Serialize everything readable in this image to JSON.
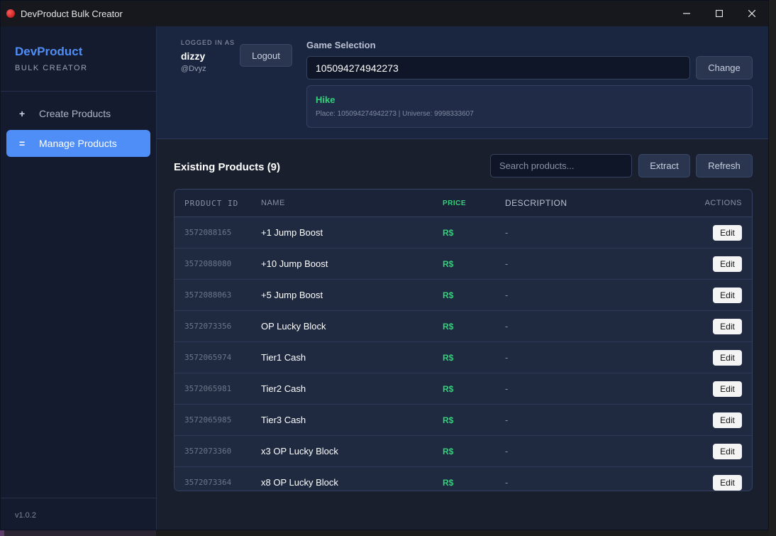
{
  "window": {
    "title": "DevProduct Bulk Creator"
  },
  "sidebar": {
    "brand_title": "DevProduct",
    "brand_subtitle": "BULK CREATOR",
    "items": [
      {
        "icon": "plus-icon",
        "glyph": "+",
        "label": "Create Products",
        "active": false
      },
      {
        "icon": "list-icon",
        "glyph": "=",
        "label": "Manage Products",
        "active": true
      }
    ],
    "version": "v1.0.2"
  },
  "header": {
    "logged_in_label": "LOGGED IN AS",
    "username": "dizzy",
    "handle": "@Dvyz",
    "logout_label": "Logout",
    "game_selection_label": "Game Selection",
    "game_id_value": "105094274942273",
    "change_label": "Change",
    "game": {
      "name": "Hike",
      "meta": "Place: 105094274942273 | Universe: 9998333607"
    }
  },
  "products": {
    "title": "Existing Products (9)",
    "search_placeholder": "Search products...",
    "extract_label": "Extract",
    "refresh_label": "Refresh",
    "columns": {
      "id": "PRODUCT ID",
      "name": "NAME",
      "price": "PRICE",
      "description": "DESCRIPTION",
      "actions": "ACTIONS"
    },
    "rows": [
      {
        "id": "3572088165",
        "name": "+1 Jump Boost",
        "price": "R$",
        "description": "-",
        "action": "Edit"
      },
      {
        "id": "3572088080",
        "name": "+10 Jump Boost",
        "price": "R$",
        "description": "-",
        "action": "Edit"
      },
      {
        "id": "3572088063",
        "name": "+5 Jump Boost",
        "price": "R$",
        "description": "-",
        "action": "Edit"
      },
      {
        "id": "3572073356",
        "name": "OP Lucky Block",
        "price": "R$",
        "description": "-",
        "action": "Edit"
      },
      {
        "id": "3572065974",
        "name": "Tier1 Cash",
        "price": "R$",
        "description": "-",
        "action": "Edit"
      },
      {
        "id": "3572065981",
        "name": "Tier2 Cash",
        "price": "R$",
        "description": "-",
        "action": "Edit"
      },
      {
        "id": "3572065985",
        "name": "Tier3 Cash",
        "price": "R$",
        "description": "-",
        "action": "Edit"
      },
      {
        "id": "3572073360",
        "name": "x3 OP Lucky Block",
        "price": "R$",
        "description": "-",
        "action": "Edit"
      },
      {
        "id": "3572073364",
        "name": "x8 OP Lucky Block",
        "price": "R$",
        "description": "-",
        "action": "Edit"
      }
    ]
  },
  "colors": {
    "accent": "#4f8ef7",
    "price_green": "#33d17a",
    "background": "#1a1f2e"
  }
}
